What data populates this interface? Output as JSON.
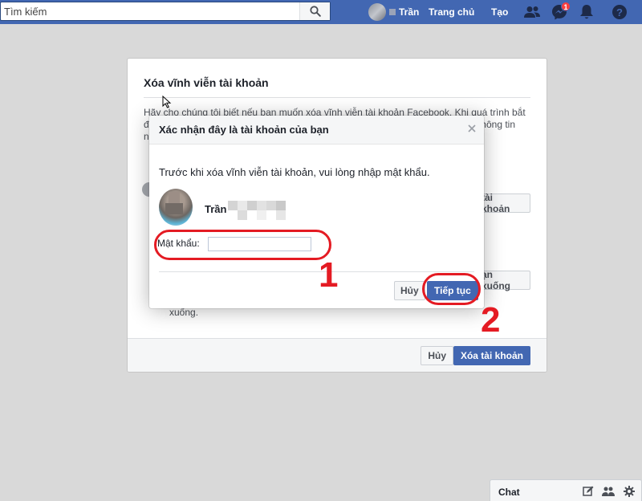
{
  "topbar": {
    "search_placeholder": "Tìm kiếm",
    "profile_name": "Trần",
    "nav_home": "Trang chủ",
    "nav_create": "Tạo",
    "messenger_badge": "1",
    "icons": [
      "search-icon",
      "friends-icon",
      "messenger-icon",
      "notifications-icon",
      "help-icon"
    ]
  },
  "background_dialog": {
    "title": "Xóa vĩnh viễn tài khoản",
    "text": "Hãy cho chúng tôi biết nếu bạn muốn xóa vĩnh viễn tài khoản Facebook. Khi quá trình bắt đầu, bạn không thể kích hoạt lại tài khoản hoặc khôi phục bất kỳ nội dung hay thông tin nào mà bạn đã thêm. Tải thông tin xuống",
    "button_1": "tài khoản",
    "button_2": "ạn xuống",
    "partial_text": "xuống.",
    "cancel_label": "Hủy",
    "delete_label": "Xóa tài khoản"
  },
  "confirm_dialog": {
    "title": "Xác nhận đây là tài khoản của bạn",
    "description": "Trước khi xóa vĩnh viễn tài khoản, vui lòng nhập mật khẩu.",
    "username": "Trần",
    "password_label": "Mật khẩu:",
    "password_value": "",
    "cancel_label": "Hủy",
    "continue_label": "Tiếp tục"
  },
  "annotations": {
    "step_1": "1",
    "step_2": "2",
    "color": "#e41b23"
  },
  "chat": {
    "label": "Chat"
  },
  "colors": {
    "brand": "#4267b2",
    "page_bg": "#d9d9d9"
  }
}
